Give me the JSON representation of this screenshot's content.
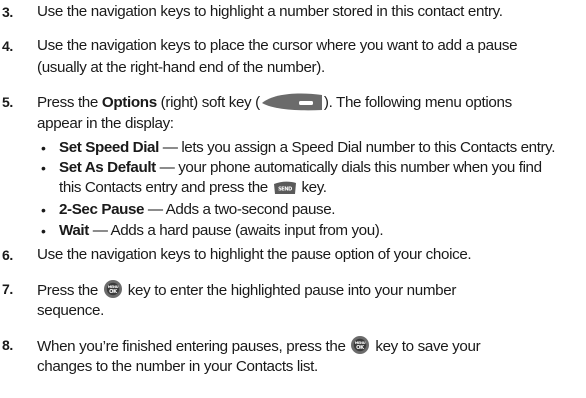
{
  "steps": [
    {
      "number": "3.",
      "text": "Use the navigation keys to highlight a number stored in this contact entry."
    },
    {
      "number": "4.",
      "line1": "Use the navigation keys to place the cursor where you want to add a pause",
      "line2": "(usually at the right-hand end of the number)."
    },
    {
      "number": "5.",
      "pre": "Press the ",
      "bold": "Options",
      "mid": " (right) soft key (",
      "post": "). The following menu options",
      "line2": "appear in the display:"
    },
    {
      "number": "6.",
      "text": "Use the navigation keys to highlight the pause option of your choice."
    },
    {
      "number": "7.",
      "pre": "Press the ",
      "post": " key to enter the highlighted pause into your number",
      "line2": "sequence."
    },
    {
      "number": "8.",
      "pre": "When you’re finished entering pauses, press the ",
      "post": " key to save your",
      "line2": "changes to the number in your Contacts list."
    }
  ],
  "options": [
    {
      "bold": "Set Speed Dial",
      "text": " — lets you assign a Speed Dial number to this Contacts entry."
    },
    {
      "bold": "Set As Default",
      "text": " — your phone automatically dials this number when you find",
      "line2_pre": "this Contacts entry and press the ",
      "line2_post": " key."
    },
    {
      "bold": "2-Sec Pause",
      "text": " — Adds a two-second pause."
    },
    {
      "bold": "Wait",
      "text": " — Adds a hard pause (awaits input from you)."
    }
  ],
  "bullet_char": "•",
  "icons": {
    "softkey": "right-soft-key-icon",
    "send": "send-key-icon",
    "ok": "menu-ok-key-icon"
  },
  "key_labels": {
    "send": "SEND",
    "ok_top": "MENU",
    "ok_bottom": "OK"
  },
  "colors": {
    "text": "#1a1a1a",
    "key_fill": "#6b6b6b",
    "key_dark": "#3a3a3a"
  }
}
